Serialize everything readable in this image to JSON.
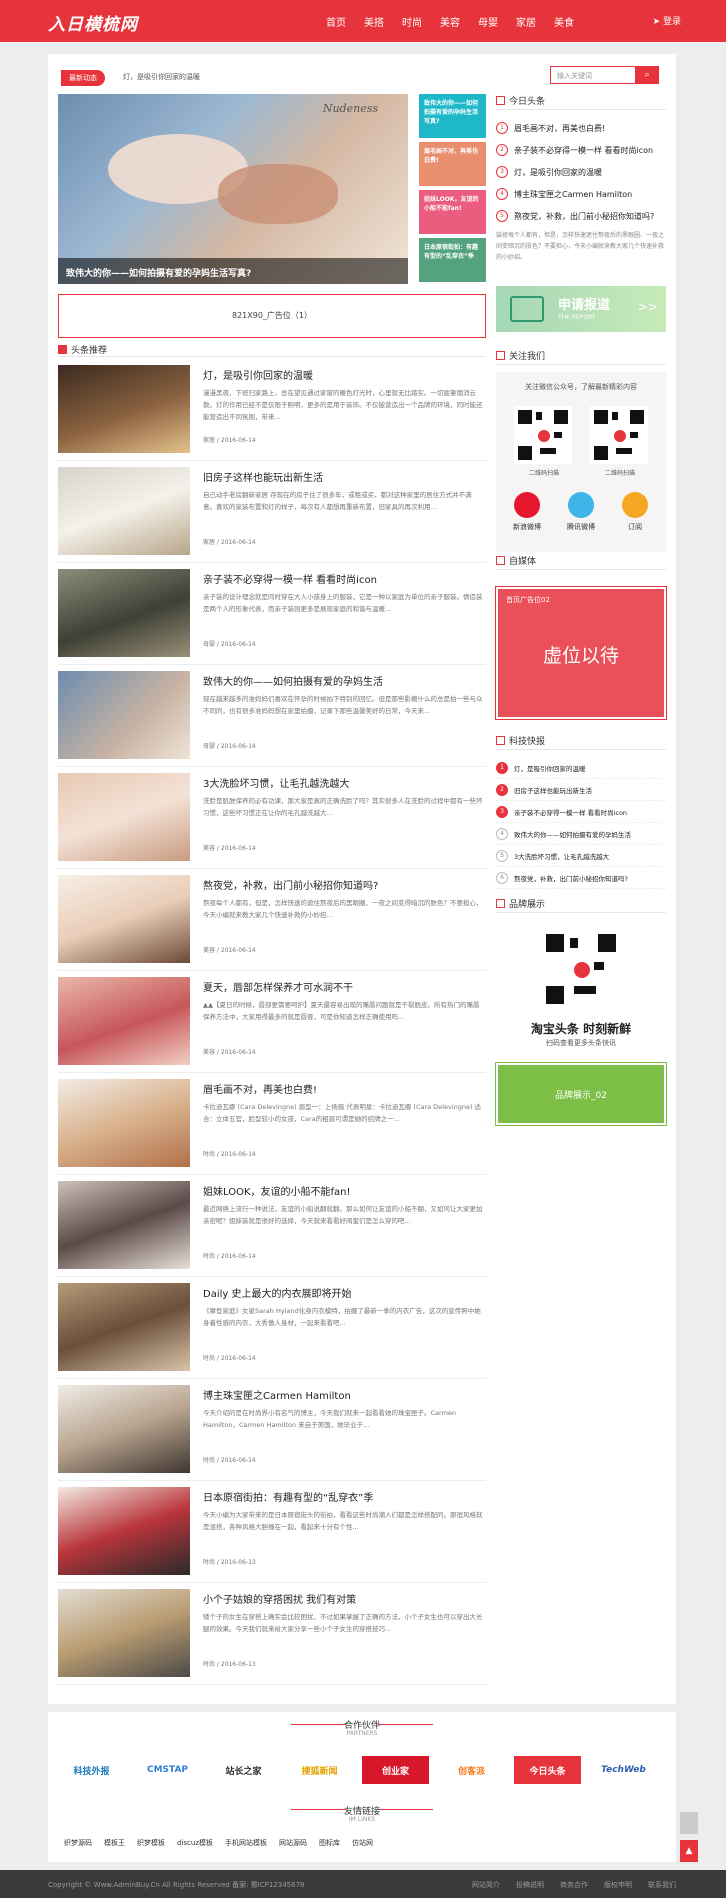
{
  "header": {
    "logo": "入日横梳网",
    "nav": [
      "首页",
      "美搭",
      "时尚",
      "美容",
      "母婴",
      "家居",
      "美食"
    ],
    "login": "登录"
  },
  "newsbar": {
    "badge": "最新动态",
    "text": "灯，是吸引你回家的温暖"
  },
  "search": {
    "placeholder": "输入关键词",
    "button_icon": "search-icon"
  },
  "hero": {
    "caption": "致伟大的你——如何拍摄有爱的孕妈生活写真?",
    "script_text": "Nudeness"
  },
  "hero_thumbs": [
    {
      "text": "致伟大的你——如何拍摄有爱的孕妈生活写真?",
      "color": "#1eb8c8"
    },
    {
      "text": "眉毛画不对，再美也白费!",
      "color": "#e98f70"
    },
    {
      "text": "姐妹LOOK，友谊的小船不能fan!",
      "color": "#ea5d7e"
    },
    {
      "text": "日本原宿街拍：有趣有型的“乱穿衣”季",
      "color": "#54a37e"
    }
  ],
  "ad": {
    "text": "821X90_广告位（1）"
  },
  "section_title": "头条推荐",
  "articles": [
    {
      "title": "灯，是吸引你回家的温暖",
      "desc": "漫漫黑夜，下班归家路上，总在望见通过家窗的暖色灯光时，心里就无比踏实。一切疲惫烟消云散。灯的作用已经不是仅限于照明，更多的是用于装饰。不仅能营造出一个品牌的环境，同时能还能营造出不同氛围，带来...",
      "meta": "家居 / 2016-06-14"
    },
    {
      "title": "旧房子这样也能玩出新生活",
      "desc": "自己动手老房翻新家居 存现在的房子住了很多年，或租或买，都对这种家里的居住方式并不满意。喜欢的家装布置和灯的样子，每次有人都想再重新布置，旧家具的再次利用...",
      "meta": "家居 / 2016-06-14"
    },
    {
      "title": "亲子装不必穿得一模一样 看看时尚icon",
      "desc": "亲子装的设计理念就是同时穿在大人小孩身上的服装，它是一种以家庭为单位的亲子服装。情侣装是两个人的形象代表，而亲子装则更多是展现家庭的和谐与温暖...",
      "meta": "母婴 / 2016-06-14"
    },
    {
      "title": "致伟大的你——如何拍摄有爱的孕妈生活",
      "desc": "现在越来越多的准妈妈们喜欢在怀孕的时候拍下特别的回忆。但是那些影棚什么的总是拍一些与众不同的，也有很多准妈妈想在家里拍摄，记录下那些温馨美好的日常，今天来...",
      "meta": "母婴 / 2016-06-14"
    },
    {
      "title": "3大洗脸坏习惯，让毛孔越洗越大",
      "desc": "洗脸是肌肤保养的必有功课，那大家是真的正确洗脸了吗？其实很多人在洗脸的过程中都有一些坏习惯，这些坏习惯正在让你的毛孔越洗越大...",
      "meta": "美容 / 2016-06-14"
    },
    {
      "title": "熬夜党，补救，出门前小秘招你知道吗?",
      "desc": "熬夜每个人都有，但是，怎样快速的遮住熬夜后的黑眼圈、一夜之间变得暗沉的肤色？不要担心，今天小编就来教大家几个快速补救的小妙招...",
      "meta": "美容 / 2016-06-14"
    },
    {
      "title": "夏天，唇部怎样保养才可水润不干",
      "desc": "▲▲【夏日的时候，唇部更需要呵护】夏天最容易出现的嘴唇问题就是干裂脱皮。所有热门的嘴唇保养方法中，大家用得最多的就是唇膏，可是你知道怎样正确使用吗...",
      "meta": "美容 / 2016-06-14"
    },
    {
      "title": "眉毛画不对，再美也白费!",
      "desc": "卡拉迪瓦娜 (Cara Delevingne) 眉型一：上扬眉 代表明星：卡拉迪瓦娜 (Cara Delevingne) 适合：立体五官，脸型较小的女孩，Cara的粗眉可谓是她的招牌之一...",
      "meta": "时尚 / 2016-06-14"
    },
    {
      "title": "姐妹LOOK，友谊的小船不能fan!",
      "desc": "最近网络上流行一种说法，友谊的小船说翻就翻。那么如何让友谊的小船不翻，又如何让大家更加亲密呢？姐妹装就是很好的选择，今天就来看看好闺蜜们是怎么穿的吧...",
      "meta": "时尚 / 2016-06-14"
    },
    {
      "title": "Daily 史上最大的内衣展即将开始",
      "desc": "《摩登家庭》女星Sarah Hyland化身内衣模特，拍摄了最新一季的内衣广告，这次的宣传照中她身着性感的内衣，大秀傲人身材，一起来看看吧...",
      "meta": "时尚 / 2016-06-14"
    },
    {
      "title": "博主珠宝匣之Carmen Hamilton",
      "desc": "今天介绍的是在时尚界小有名气的博主，今天我们就来一起看看她的珠宝匣子。Carmen Hamilton，Carmen Hamilton 来自于美国，她毕业于...",
      "meta": "时尚 / 2016-06-14"
    },
    {
      "title": "日本原宿街拍：有趣有型的“乱穿衣”季",
      "desc": "今天小编为大家带来的是日本原宿街头的街拍，看看这些时尚潮人们都是怎样搭配的。原宿风格就是混搭，各种风格大胆撞在一起，看起来十分有个性...",
      "meta": "时尚 / 2016-06-13"
    },
    {
      "title": "小个子姑娘的穿搭困扰 我们有对策",
      "desc": "矮个子的女生在穿搭上确实会比较困扰，不过如果掌握了正确的方法，小个子女生也可以穿出大长腿的效果。今天我们就来给大家分享一些小个子女生的穿搭技巧...",
      "meta": "时尚 / 2016-06-13"
    }
  ],
  "sidebar": {
    "top_title": "今日头条",
    "top_list": [
      "眉毛画不对，再美也白费!",
      "亲子装不必穿得一模一样 看看时尚icon",
      "灯，是吸引你回家的温暖",
      "博主珠宝匣之Carmen Hamilton",
      "熬夜党，补救，出门前小秘招你知道吗?"
    ],
    "top_text": "装修每个人都有，但是，怎样快速遮住熬夜后的黑眼圈、一夜之间变暗沉的肤色？不要担心，今天小编就来教大家几个快速补救的小妙招。",
    "report_title": "申请报道",
    "report_sub": "THE REPORT",
    "report_arrow": ">>",
    "follow_title": "关注我们",
    "follow_text": "关注微信公众号，了解最新精彩内容",
    "qr_labels": [
      "二维码扫描",
      "二维码扫描"
    ],
    "social": [
      {
        "label": "新浪微博",
        "color": "#e6162d",
        "icon": "weibo-icon"
      },
      {
        "label": "腾讯微博",
        "color": "#3eb4e8",
        "icon": "tencent-weibo-icon"
      },
      {
        "label": "订阅",
        "color": "#f5a623",
        "icon": "rss-icon"
      }
    ],
    "media_title": "自媒体",
    "media_ad_label": "首页广告位02",
    "media_ad_text": "虚位以待",
    "tech_title": "科技快报",
    "tech_list": [
      "灯，是吸引你回家的温暖",
      "旧房子这样也能玩出新生活",
      "亲子装不必穿得一模一样 看看时尚icon",
      "致伟大的你——如何拍摄有爱的孕妈生活",
      "3大洗脸坏习惯，让毛孔越洗越大",
      "熬夜党，补救，出门前小秘招你知道吗?"
    ],
    "brand_title": "品牌展示",
    "brand_slogan": "淘宝头条 时刻新鲜",
    "brand_sub": "扫码查看更多头条快讯",
    "brand_btn": "品牌展示_02"
  },
  "partners": {
    "title": "合作伙伴",
    "sub": "PARTNERS",
    "items": [
      {
        "name": "科技外报",
        "color": "#1a7bbf"
      },
      {
        "name": "CMSTAP",
        "color": "#2e7fd6"
      },
      {
        "name": "站长之家",
        "color": "#333333"
      },
      {
        "name": "搜狐新闻",
        "color": "#e6a100"
      },
      {
        "name": "创业家",
        "color": "#d7182a"
      },
      {
        "name": "创客派",
        "color": "#f2791c"
      },
      {
        "name": "今日头条",
        "color": "#e7333b"
      },
      {
        "name": "TechWeb",
        "color": "#2a5db0"
      }
    ]
  },
  "friend_links": {
    "title": "友情链接",
    "sub": "IM LINKS",
    "items": [
      "织梦源码",
      "模板王",
      "织梦模板",
      "discuz模板",
      "手机网站模板",
      "网站源码",
      "图标库",
      "仿站网"
    ]
  },
  "footer": {
    "copyright": "Copyright © Www.AdminBuy.Cn All Rights Reserved 备案: 蜀ICP12345678",
    "links": [
      "网站简介",
      "投稿说明",
      "商务合作",
      "版权申明",
      "联系我们"
    ]
  }
}
